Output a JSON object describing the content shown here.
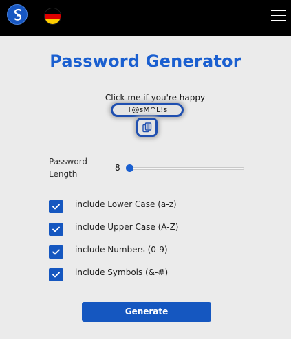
{
  "header": {
    "logo_icon": "s-logo-icon",
    "language_icon": "german-flag-icon",
    "flag_colors": [
      "#000000",
      "#dd0000",
      "#ffce00"
    ],
    "menu_icon": "hamburger-menu-icon"
  },
  "main": {
    "title": "Password Generator",
    "happy_text": "Click me if you're happy",
    "password": "T@sM^L!s",
    "copy_icon": "copy-icon"
  },
  "length": {
    "label": "Password Length",
    "value": "8",
    "slider_fraction": 0.0
  },
  "options": [
    {
      "label": "include Lower Case (a-z)",
      "checked": true
    },
    {
      "label": "include Upper Case (A-Z)",
      "checked": true
    },
    {
      "label": "include Numbers (0-9)",
      "checked": true
    },
    {
      "label": "include Symbols (&-#)",
      "checked": true
    }
  ],
  "generate_label": "Generate",
  "colors": {
    "accent": "#1557c0",
    "title": "#1a5fd0",
    "background": "#ebebeb",
    "header": "#000000"
  }
}
